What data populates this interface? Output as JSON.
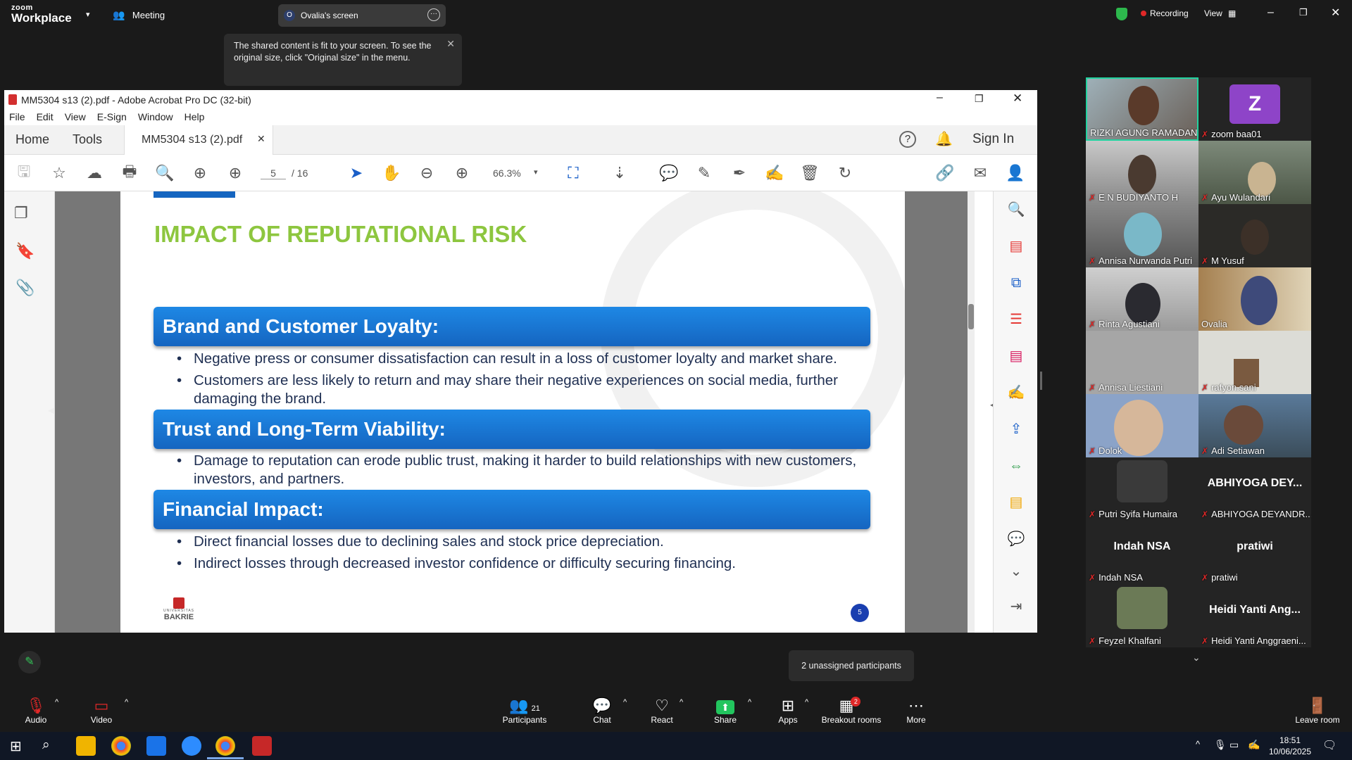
{
  "zoom": {
    "logo_top": "zoom",
    "logo_bottom": "Workplace",
    "meeting_label": "Meeting",
    "screen_badge": "O",
    "screen_label": "Ovalia's screen",
    "recording_label": "Recording",
    "view_label": "View",
    "tooltip": "The shared content is fit to your screen. To see the original size, click \"Original size\" in the menu.",
    "unassigned": "2 unassigned participants",
    "toolbar": {
      "audio": "Audio",
      "video": "Video",
      "participants": "Participants",
      "participants_count": "21",
      "chat": "Chat",
      "react": "React",
      "share": "Share",
      "apps": "Apps",
      "breakout": "Breakout rooms",
      "breakout_badge": "2",
      "more": "More",
      "leave": "Leave room"
    }
  },
  "acrobat": {
    "title": "MM5304 s13 (2).pdf - Adobe Acrobat Pro DC (32-bit)",
    "menu": [
      "File",
      "Edit",
      "View",
      "E-Sign",
      "Window",
      "Help"
    ],
    "tab_home": "Home",
    "tab_tools": "Tools",
    "doc_tab": "MM5304 s13 (2).pdf",
    "sign_in": "Sign In",
    "page_current": "5",
    "page_total": "/ 16",
    "zoom": "66.3%"
  },
  "slide": {
    "title": "IMPACT OF REPUTATIONAL RISK",
    "sections": [
      {
        "heading": "Brand and Customer Loyalty:",
        "bullets": [
          "Negative press or consumer dissatisfaction can result in a loss of customer loyalty and market share.",
          "Customers are less likely to return and may share their negative experiences on social media, further damaging the brand."
        ]
      },
      {
        "heading": "Trust and Long-Term Viability:",
        "bullets": [
          "Damage to reputation can erode public trust, making it harder to build relationships with new customers, investors, and partners."
        ]
      },
      {
        "heading": "Financial Impact:",
        "bullets": [
          "Direct financial losses due to declining sales and stock price depreciation.",
          "Indirect losses through decreased investor confidence or difficulty securing financing."
        ]
      }
    ],
    "logo_text": "BAKRIE",
    "logo_sub": "UNIVERSITAS",
    "page_badge": "5"
  },
  "participants": [
    {
      "name": "RIZKI AGUNG RAMADANI",
      "muted": false
    },
    {
      "name": "zoom baa01",
      "muted": true,
      "avatar": "Z"
    },
    {
      "name": "E N BUDIYANTO H",
      "muted": true
    },
    {
      "name": "Ayu Wulandari",
      "muted": true
    },
    {
      "name": "Annisa Nurwanda Putri",
      "muted": true
    },
    {
      "name": "M Yusuf",
      "muted": true
    },
    {
      "name": "Rinta Agustiani",
      "muted": true
    },
    {
      "name": "Ovalia",
      "muted": false
    },
    {
      "name": "Annisa Liestiani",
      "muted": true
    },
    {
      "name": "rafyon.sani",
      "muted": true
    },
    {
      "name": "Dolok",
      "muted": true
    },
    {
      "name": "Adi Setiawan",
      "muted": true
    },
    {
      "name": "Putri Syifa Humaira",
      "muted": true
    },
    {
      "name": "ABHIYOGA DEYANDR...",
      "muted": true,
      "big": "ABHIYOGA DEY..."
    },
    {
      "name": "Indah NSA",
      "muted": true,
      "big": "Indah NSA"
    },
    {
      "name": "pratiwi",
      "muted": true,
      "big": "pratiwi"
    },
    {
      "name": "Feyzel Khalfani",
      "muted": true
    },
    {
      "name": "Heidi Yanti Anggraeni...",
      "muted": true,
      "big": "Heidi Yanti Ang..."
    }
  ],
  "taskbar": {
    "time": "18:51",
    "date": "10/06/2025"
  }
}
